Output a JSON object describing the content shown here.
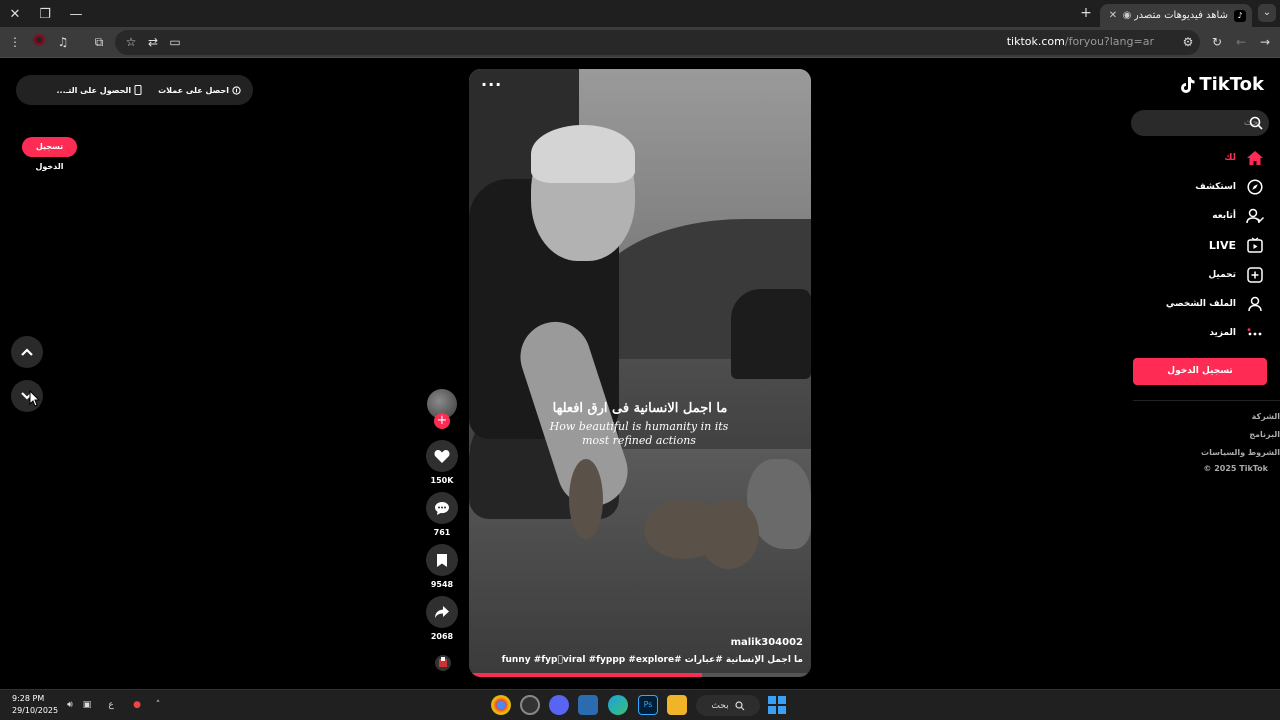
{
  "browser": {
    "tab_title": "شاهد فيديوهات متصدرة | ok",
    "url_host": "tiktok.com",
    "url_path": "/foryou?lang=ar"
  },
  "header": {
    "pill_items": [
      "احصل على عملات",
      "الحصول على التـ..."
    ],
    "login_label": "تسجيل الدخول"
  },
  "video": {
    "menu": "···",
    "caption_ar": "ما اجمل الانسانية فى ارق افعلها",
    "caption_en": "How beautiful is humanity in its most refined actions",
    "username": "malik304002",
    "hashtags": "ما اجمل الإنسانية  #عبارات  #funny  #fyp゚viral  #fyppp  #explore",
    "progress_fraction": 0.68
  },
  "actions": {
    "likes": "150K",
    "comments": "761",
    "saves": "9548",
    "shares": "2068"
  },
  "sidebar": {
    "logo_text": "TikTok",
    "search_placeholder": "بحث",
    "nav": [
      {
        "label": "لك",
        "icon": "home-icon"
      },
      {
        "label": "استكشف",
        "icon": "compass-icon"
      },
      {
        "label": "أتابعه",
        "icon": "following-icon"
      },
      {
        "label": "LIVE",
        "icon": "live-icon"
      },
      {
        "label": "تحميل",
        "icon": "upload-icon"
      },
      {
        "label": "الملف الشخصي",
        "icon": "profile-icon"
      },
      {
        "label": "المزيد",
        "icon": "more-icon"
      }
    ],
    "login_label": "تسجيل الدخول",
    "footer": [
      "الشركة",
      "البرنامج",
      "الشروط والسياسات",
      "© 2025 TikTok"
    ]
  },
  "taskbar": {
    "time": "9:28 PM",
    "date": "29/10/2025",
    "lang": "ع",
    "search_label": "بحث"
  },
  "colors": {
    "accent": "#fe2c55"
  }
}
